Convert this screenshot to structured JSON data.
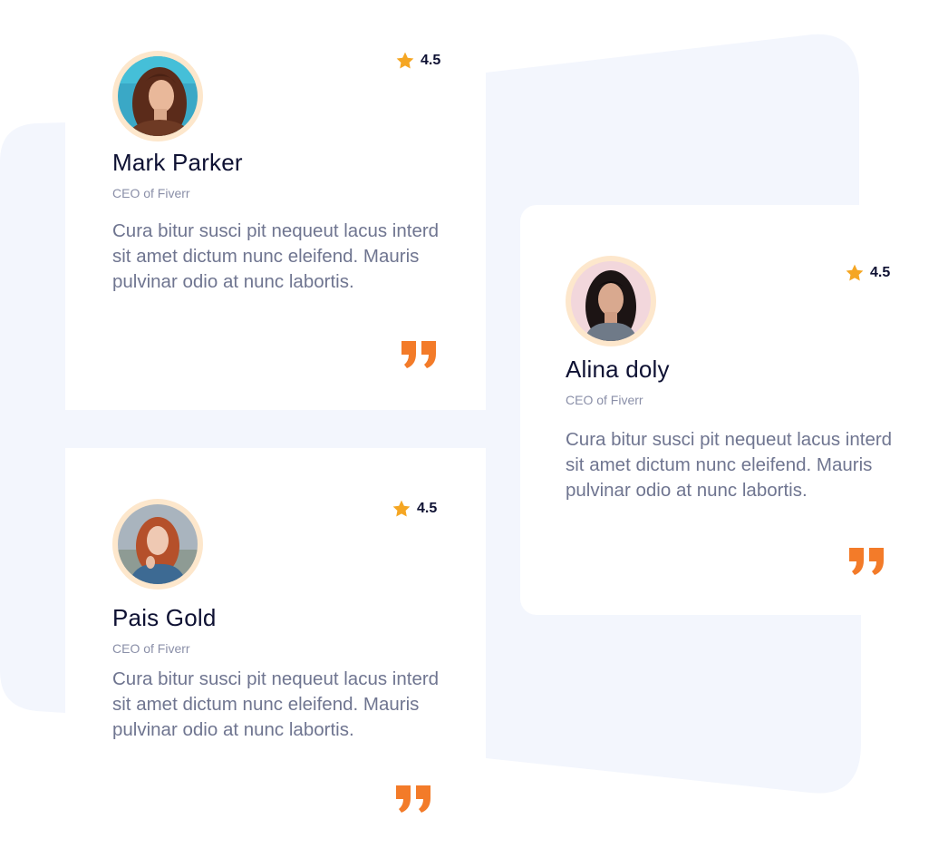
{
  "colors": {
    "accent_orange": "#f37b29",
    "star": "#f5a623",
    "name_text": "#0e1133",
    "body_text": "#6f7590",
    "role_text": "#8a8fa8",
    "background_shape": "#f3f6fd",
    "avatar_ring": "#fde7cc"
  },
  "testimonials": [
    {
      "name": "Mark Parker",
      "role": "CEO of Fiverr",
      "rating": "4.5",
      "text": "Cura bitur susci pit nequeut lacus interd sit amet dictum nunc eleifend. Mauris pulvinar odio at nunc labortis.",
      "icons": {
        "rating": "star-icon",
        "quote": "quote-icon"
      }
    },
    {
      "name": "Alina doly",
      "role": "CEO of Fiverr",
      "rating": "4.5",
      "text": "Cura bitur susci pit nequeut lacus interd sit amet dictum nunc eleifend. Mauris pulvinar odio at nunc labortis.",
      "icons": {
        "rating": "star-icon",
        "quote": "quote-icon"
      }
    },
    {
      "name": "Pais Gold",
      "role": "CEO of Fiverr",
      "rating": "4.5",
      "text": "Cura bitur susci pit nequeut lacus interd sit amet dictum nunc eleifend. Mauris pulvinar odio at nunc labortis.",
      "icons": {
        "rating": "star-icon",
        "quote": "quote-icon"
      }
    }
  ]
}
